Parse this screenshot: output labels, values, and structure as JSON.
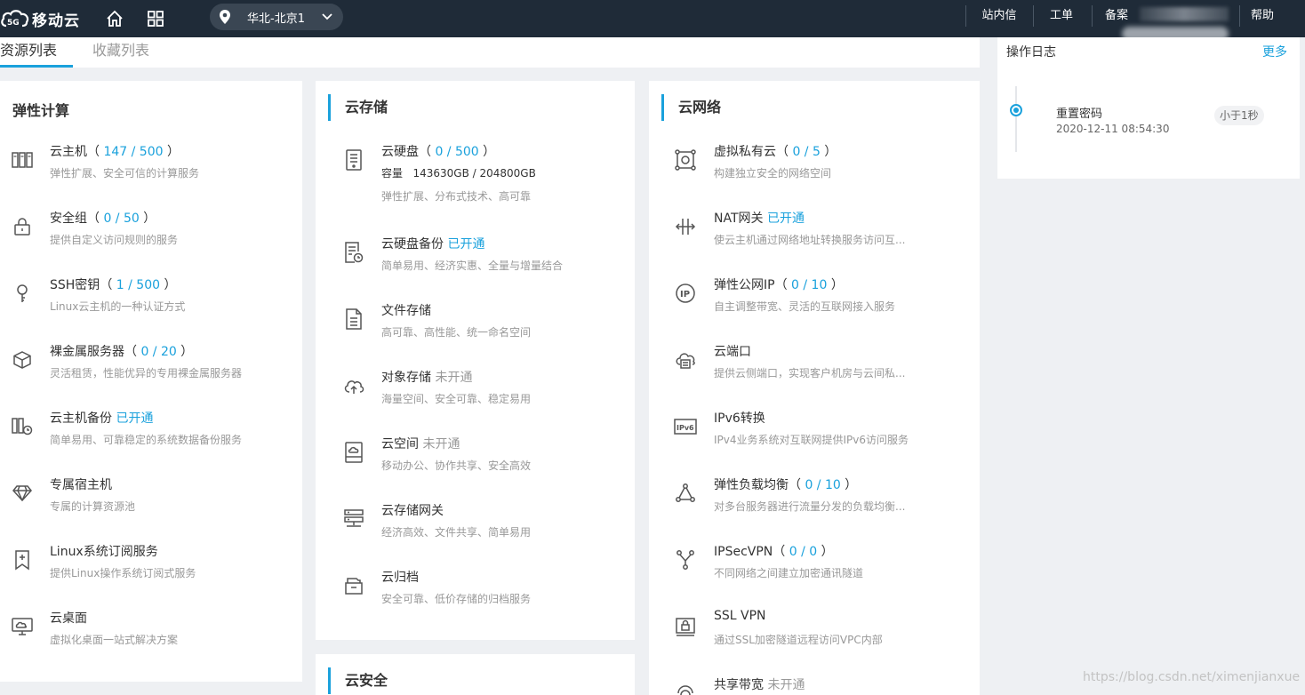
{
  "header": {
    "logo_text": "移动云",
    "region": "华北-北京1",
    "nav": [
      "站内信",
      "工单",
      "备案",
      "帮助"
    ]
  },
  "tabs": [
    {
      "label": "资源列表"
    },
    {
      "label": "收藏列表"
    }
  ],
  "compute": {
    "title": "弹性计算",
    "items": [
      {
        "name": "云主机",
        "count": "147 / 500",
        "desc": "弹性扩展、安全可信的计算服务",
        "icon": "server-icon"
      },
      {
        "name": "安全组",
        "count": "0 / 50",
        "desc": "提供自定义访问规则的服务",
        "icon": "lock-icon"
      },
      {
        "name": "SSH密钥",
        "count": "1 / 500",
        "desc": "Linux云主机的一种认证方式",
        "icon": "key-icon"
      },
      {
        "name": "裸金属服务器",
        "count": "0 / 20",
        "desc": "灵活租赁，性能优异的专用裸金属服务器",
        "icon": "cube-icon"
      },
      {
        "name": "云主机备份",
        "status": "已开通",
        "desc": "简单易用、可靠稳定的系统数据备份服务",
        "icon": "server-backup-icon"
      },
      {
        "name": "专属宿主机",
        "desc": "专属的计算资源池",
        "icon": "diamond-icon"
      },
      {
        "name": "Linux系统订阅服务",
        "desc": "提供Linux操作系统订阅式服务",
        "icon": "bookmark-plus-icon"
      },
      {
        "name": "云桌面",
        "desc": "虚拟化桌面一站式解决方案",
        "icon": "desktop-icon"
      }
    ]
  },
  "storage": {
    "title": "云存储",
    "items": [
      {
        "name": "云硬盘",
        "count": "0 / 500",
        "capacity_label": "容量",
        "capacity": "143630GB / 204800GB",
        "desc": "弹性扩展、分布式技术、高可靠",
        "icon": "disk-icon"
      },
      {
        "name": "云硬盘备份",
        "status": "已开通",
        "desc": "简单易用、经济实惠、全量与增量结合",
        "icon": "disk-backup-icon"
      },
      {
        "name": "文件存储",
        "desc": "高可靠、高性能、统一命名空间",
        "icon": "file-icon"
      },
      {
        "name": "对象存储",
        "status": "未开通",
        "desc": "海量空间、安全可靠、稳定易用",
        "icon": "cloud-upload-icon"
      },
      {
        "name": "云空间",
        "status": "未开通",
        "desc": "移动办公、协作共享、安全高效",
        "icon": "cloud-drive-icon"
      },
      {
        "name": "云存储网关",
        "desc": "经济高效、文件共享、简单易用",
        "icon": "gateway-icon"
      },
      {
        "name": "云归档",
        "desc": "安全可靠、低价存储的归档服务",
        "icon": "archive-icon"
      }
    ]
  },
  "security": {
    "title": "云安全"
  },
  "network": {
    "title": "云网络",
    "items": [
      {
        "name": "虚拟私有云",
        "count": "0 / 5",
        "desc": "构建独立安全的网络空间",
        "icon": "vpc-icon"
      },
      {
        "name": "NAT网关",
        "status": "已开通",
        "desc": "使云主机通过网络地址转换服务访问互...",
        "icon": "nat-icon"
      },
      {
        "name": "弹性公网IP",
        "count": "0 / 10",
        "desc": "自主调整带宽、灵活的互联网接入服务",
        "icon": "ip-icon"
      },
      {
        "name": "云端口",
        "desc": "提供云侧端口，实现客户机房与云间私...",
        "icon": "cloud-port-icon"
      },
      {
        "name": "IPv6转换",
        "desc": "IPv4业务系统对互联网提供IPv6访问服务",
        "icon": "ipv6-icon"
      },
      {
        "name": "弹性负载均衡",
        "count": "0 / 10",
        "desc": "对多台服务器进行流量分发的负载均衡...",
        "icon": "load-balancer-icon"
      },
      {
        "name": "IPSecVPN",
        "count": "0 / 0",
        "desc": "不同网络之间建立加密通讯隧道",
        "icon": "vpn-icon"
      },
      {
        "name": "SSL VPN",
        "desc": "通过SSL加密隧道远程访问VPC内部",
        "icon": "ssl-vpn-icon"
      },
      {
        "name": "共享带宽",
        "status": "未开通",
        "icon": "bandwidth-icon"
      }
    ]
  },
  "log": {
    "title": "操作日志",
    "more": "更多",
    "entries": [
      {
        "action": "重置密码",
        "time": "2020-12-11 08:54:30",
        "ago": "小于1秒"
      }
    ]
  },
  "watermark": "https://blog.csdn.net/ximenjianxue",
  "colors": {
    "accent": "#1aa1dc",
    "topbar": "#1f2b38"
  }
}
